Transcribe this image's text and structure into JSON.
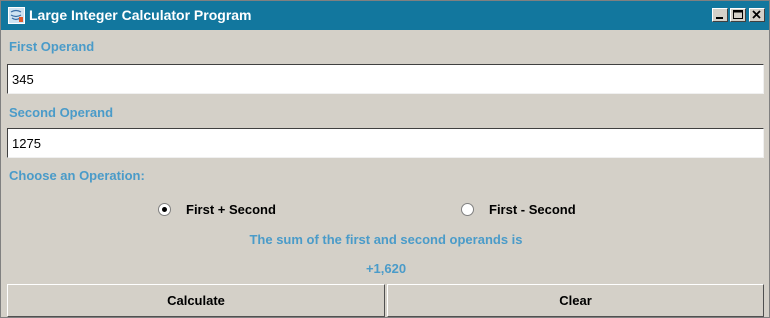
{
  "window": {
    "title": "Large Integer Calculator Program",
    "titlebar_color": "#12779e",
    "controls": [
      "minimize-icon",
      "maximize-icon",
      "close-icon"
    ]
  },
  "first_operand": {
    "label": "First Operand",
    "value": "345"
  },
  "second_operand": {
    "label": "Second Operand",
    "value": "1275"
  },
  "operation": {
    "label": "Choose an Operation:",
    "options": [
      {
        "label": "First + Second",
        "selected": true
      },
      {
        "label": "First - Second",
        "selected": false
      }
    ]
  },
  "result": {
    "message": "The sum of the first and second operands is",
    "value": "+1,620"
  },
  "buttons": {
    "calculate": "Calculate",
    "clear": "Clear"
  },
  "accent_color": "#4a9bc9"
}
